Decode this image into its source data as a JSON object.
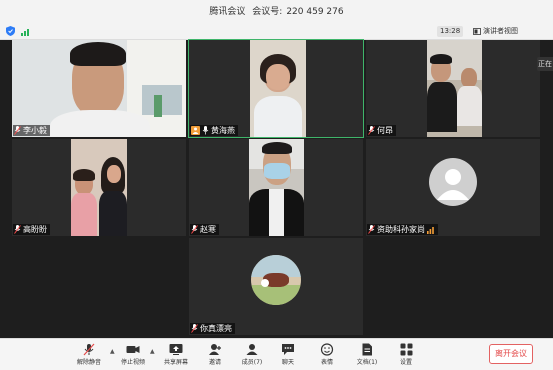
{
  "window": {
    "app_name": "腾讯会议",
    "meeting_id_label": "会议号:",
    "meeting_id": "220 459 276"
  },
  "status": {
    "timer": "13:28",
    "speaker_view_label": "演讲者视图",
    "side_tab_label": "正在"
  },
  "participants": [
    {
      "name": "李小毅"
    },
    {
      "name": "黄海燕"
    },
    {
      "name": "何昂"
    },
    {
      "name": "高盼盼"
    },
    {
      "name": "赵寒"
    },
    {
      "name": "资助科孙家尚"
    },
    {
      "name": "你真漂亮"
    }
  ],
  "toolbar": {
    "unmute": "解除静音",
    "stop_video": "停止视频",
    "share_screen": "共享屏幕",
    "invite": "邀请",
    "members": "成员(7)",
    "chat": "聊天",
    "reactions": "表情",
    "docs": "文档(1)",
    "settings": "设置",
    "leave": "离开会议"
  },
  "colors": {
    "active_speaker_border": "#3fb56a",
    "leave_button": "#e34848",
    "host_badge": "#f29d38"
  }
}
